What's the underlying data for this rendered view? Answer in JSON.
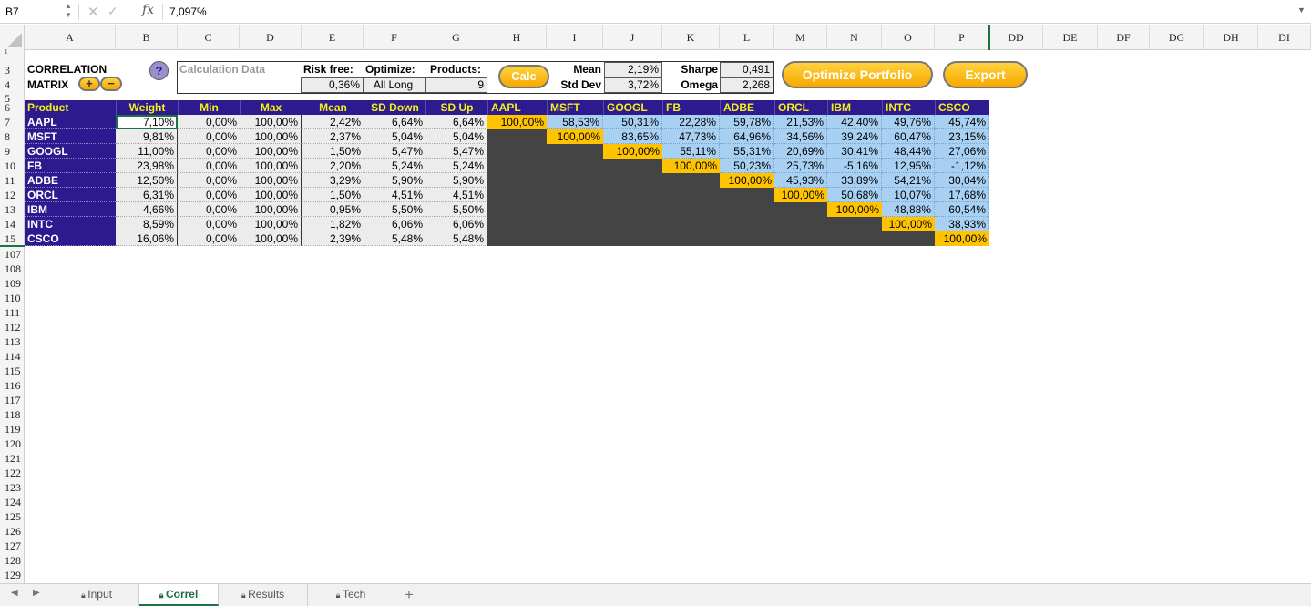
{
  "formula_bar": {
    "cell_ref": "B7",
    "value": "7,097%"
  },
  "columns": [
    "A",
    "B",
    "C",
    "D",
    "E",
    "F",
    "G",
    "H",
    "I",
    "J",
    "K",
    "L",
    "M",
    "N",
    "O",
    "P",
    "DD",
    "DE",
    "DF",
    "DG",
    "DH",
    "DI"
  ],
  "row_numbers": [
    "1",
    "3",
    "4",
    "5",
    "6",
    "7",
    "8",
    "9",
    "10",
    "11",
    "12",
    "13",
    "14",
    "15",
    "107",
    "108",
    "109",
    "110",
    "111",
    "112",
    "113",
    "114",
    "115",
    "116",
    "117",
    "118",
    "119",
    "120",
    "121",
    "122",
    "123",
    "124",
    "125",
    "126",
    "127",
    "128",
    "129"
  ],
  "title": {
    "line1": "CORRELATION",
    "line2": "MATRIX",
    "plus": "+",
    "minus": "−",
    "help": "?"
  },
  "calc_data": {
    "label": "Calculation Data",
    "risk_free_label": "Risk free:",
    "risk_free": "0,36%",
    "optimize_label": "Optimize:",
    "optimize": "All Long",
    "products_label": "Products:",
    "products": "9",
    "calc_button": "Calc",
    "mean_label": "Mean",
    "mean": "2,19%",
    "sd_label": "Std Dev",
    "sd": "3,72%",
    "sharpe_label": "Sharpe",
    "sharpe": "0,491",
    "omega_label": "Omega",
    "omega": "2,268",
    "optimize_button": "Optimize Portfolio",
    "export_button": "Export"
  },
  "table": {
    "headers": [
      "Product",
      "Weight",
      "Min",
      "Max",
      "Mean",
      "SD Down",
      "SD Up"
    ],
    "tickers": [
      "AAPL",
      "MSFT",
      "GOOGL",
      "FB",
      "ADBE",
      "ORCL",
      "IBM",
      "INTC",
      "CSCO"
    ],
    "rows": [
      [
        "AAPL",
        "7,10%",
        "0,00%",
        "100,00%",
        "2,42%",
        "6,64%",
        "6,64%"
      ],
      [
        "MSFT",
        "9,81%",
        "0,00%",
        "100,00%",
        "2,37%",
        "5,04%",
        "5,04%"
      ],
      [
        "GOOGL",
        "11,00%",
        "0,00%",
        "100,00%",
        "1,50%",
        "5,47%",
        "5,47%"
      ],
      [
        "FB",
        "23,98%",
        "0,00%",
        "100,00%",
        "2,20%",
        "5,24%",
        "5,24%"
      ],
      [
        "ADBE",
        "12,50%",
        "0,00%",
        "100,00%",
        "3,29%",
        "5,90%",
        "5,90%"
      ],
      [
        "ORCL",
        "6,31%",
        "0,00%",
        "100,00%",
        "1,50%",
        "4,51%",
        "4,51%"
      ],
      [
        "IBM",
        "4,66%",
        "0,00%",
        "100,00%",
        "0,95%",
        "5,50%",
        "5,50%"
      ],
      [
        "INTC",
        "8,59%",
        "0,00%",
        "100,00%",
        "1,82%",
        "6,06%",
        "6,06%"
      ],
      [
        "CSCO",
        "16,06%",
        "0,00%",
        "100,00%",
        "2,39%",
        "5,48%",
        "5,48%"
      ]
    ],
    "correlations": [
      [
        "100,00%",
        "58,53%",
        "50,31%",
        "22,28%",
        "59,78%",
        "21,53%",
        "42,40%",
        "49,76%",
        "45,74%"
      ],
      [
        "",
        "100,00%",
        "83,65%",
        "47,73%",
        "64,96%",
        "34,56%",
        "39,24%",
        "60,47%",
        "23,15%"
      ],
      [
        "",
        "",
        "100,00%",
        "55,11%",
        "55,31%",
        "20,69%",
        "30,41%",
        "48,44%",
        "27,06%"
      ],
      [
        "",
        "",
        "",
        "100,00%",
        "50,23%",
        "25,73%",
        "-5,16%",
        "12,95%",
        "-1,12%"
      ],
      [
        "",
        "",
        "",
        "",
        "100,00%",
        "45,93%",
        "33,89%",
        "54,21%",
        "30,04%"
      ],
      [
        "",
        "",
        "",
        "",
        "",
        "100,00%",
        "50,68%",
        "10,07%",
        "17,68%"
      ],
      [
        "",
        "",
        "",
        "",
        "",
        "",
        "100,00%",
        "48,88%",
        "60,54%"
      ],
      [
        "",
        "",
        "",
        "",
        "",
        "",
        "",
        "100,00%",
        "38,93%"
      ],
      [
        "",
        "",
        "",
        "",
        "",
        "",
        "",
        "",
        "100,00%"
      ]
    ]
  },
  "sheet_tabs": [
    {
      "label": "Input",
      "active": false
    },
    {
      "label": "Correl",
      "active": true
    },
    {
      "label": "Results",
      "active": false
    },
    {
      "label": "Tech",
      "active": false
    }
  ],
  "add_sheet": "+",
  "colors": {
    "header_purple": "#2d1a8e",
    "header_text_yellow": "#f4f01a",
    "corr_blue": "#a8d0f3",
    "diag_gold": "#ffc300",
    "excel_green": "#1e7145"
  }
}
